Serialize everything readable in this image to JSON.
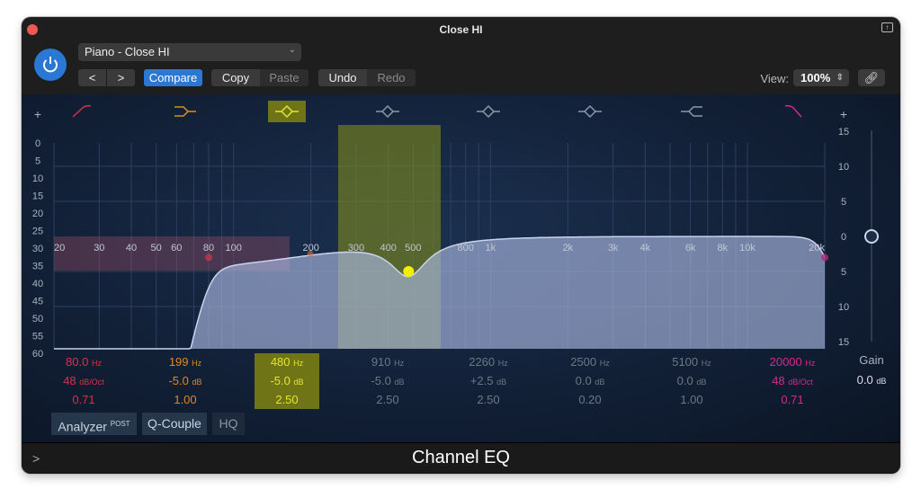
{
  "window": {
    "title": "Close HI"
  },
  "header": {
    "preset": "Piano - Close HI",
    "prev": "<",
    "next": ">",
    "compare": "Compare",
    "copy": "Copy",
    "paste": "Paste",
    "undo": "Undo",
    "redo": "Redo",
    "view_label": "View:",
    "view_value": "100%"
  },
  "graph": {
    "db_left": [
      "0",
      "5",
      "10",
      "15",
      "20",
      "25",
      "30",
      "35",
      "40",
      "45",
      "50",
      "55",
      "60"
    ],
    "db_right": [
      "15",
      "10",
      "5",
      "0",
      "5",
      "10",
      "15"
    ],
    "freq_labels": [
      "20",
      "30",
      "40",
      "50",
      "60",
      "80",
      "100",
      "200",
      "300",
      "400",
      "500",
      "800",
      "1k",
      "2k",
      "3k",
      "4k",
      "6k",
      "8k",
      "10k",
      "20k"
    ],
    "freq_values": [
      20,
      30,
      40,
      50,
      60,
      80,
      100,
      200,
      300,
      400,
      500,
      800,
      1000,
      2000,
      3000,
      4000,
      6000,
      8000,
      10000,
      20000
    ]
  },
  "bands": [
    {
      "type": "high-pass",
      "freq": "80.0",
      "freq_unit": "Hz",
      "gain": "48",
      "gain_unit": "dB/Oct",
      "q": "0.71",
      "color": "#d8304a",
      "enabled": true,
      "selected": false
    },
    {
      "type": "low-shelf",
      "freq": "199",
      "freq_unit": "Hz",
      "gain": "-5.0",
      "gain_unit": "dB",
      "q": "1.00",
      "color": "#e08a1a",
      "enabled": true,
      "selected": false
    },
    {
      "type": "peak",
      "freq": "480",
      "freq_unit": "Hz",
      "gain": "-5.0",
      "gain_unit": "dB",
      "q": "2.50",
      "color": "#e6e62a",
      "enabled": true,
      "selected": true
    },
    {
      "type": "peak",
      "freq": "910",
      "freq_unit": "Hz",
      "gain": "-5.0",
      "gain_unit": "dB",
      "q": "2.50",
      "color": "#8d98a6",
      "enabled": false,
      "selected": false
    },
    {
      "type": "peak",
      "freq": "2260",
      "freq_unit": "Hz",
      "gain": "+2.5",
      "gain_unit": "dB",
      "q": "2.50",
      "color": "#8d98a6",
      "enabled": false,
      "selected": false
    },
    {
      "type": "peak",
      "freq": "2500",
      "freq_unit": "Hz",
      "gain": "0.0",
      "gain_unit": "dB",
      "q": "0.20",
      "color": "#8d98a6",
      "enabled": false,
      "selected": false
    },
    {
      "type": "high-shelf",
      "freq": "5100",
      "freq_unit": "Hz",
      "gain": "0.0",
      "gain_unit": "dB",
      "q": "1.00",
      "color": "#8d98a6",
      "enabled": false,
      "selected": false
    },
    {
      "type": "low-pass",
      "freq": "20000",
      "freq_unit": "Hz",
      "gain": "48",
      "gain_unit": "dB/Oct",
      "q": "0.71",
      "color": "#d42a8c",
      "enabled": true,
      "selected": false
    }
  ],
  "master": {
    "label": "Gain",
    "value": "0.0",
    "unit": "dB"
  },
  "toggles": {
    "analyzer": "Analyzer",
    "analyzer_mode": "POST",
    "qcouple": "Q-Couple",
    "hq": "HQ"
  },
  "footer": {
    "plugin_name": "Channel EQ",
    "expand": ">"
  }
}
